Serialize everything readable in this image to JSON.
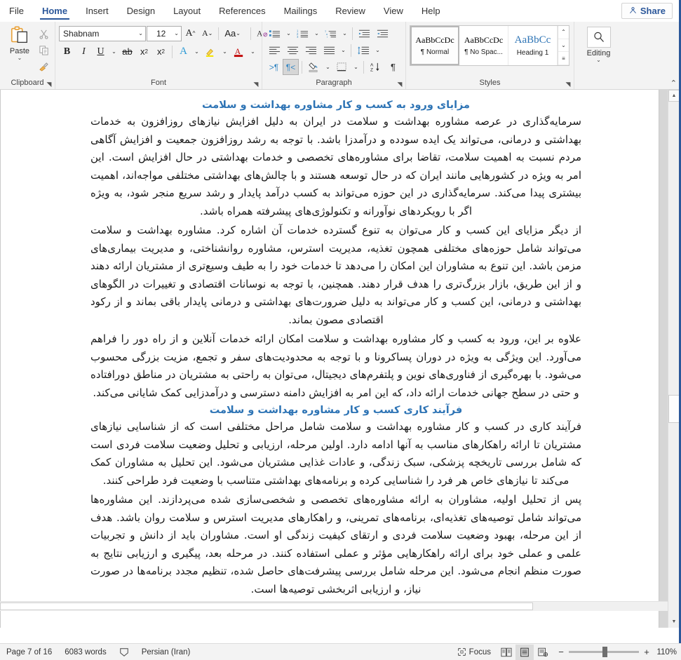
{
  "tabs": [
    {
      "label": "File",
      "active": false
    },
    {
      "label": "Home",
      "active": true
    },
    {
      "label": "Insert",
      "active": false
    },
    {
      "label": "Design",
      "active": false
    },
    {
      "label": "Layout",
      "active": false
    },
    {
      "label": "References",
      "active": false
    },
    {
      "label": "Mailings",
      "active": false
    },
    {
      "label": "Review",
      "active": false
    },
    {
      "label": "View",
      "active": false
    },
    {
      "label": "Help",
      "active": false
    }
  ],
  "share": {
    "label": "Share",
    "icon": "share-person-icon"
  },
  "ribbon": {
    "clipboard": {
      "group_label": "Clipboard",
      "paste_label": "Paste",
      "paste_caret": "⌄",
      "cut_icon": "scissors-icon",
      "copy_icon": "copy-icon",
      "format_painter_icon": "format-painter-icon",
      "launcher_icon": "dialog-launcher-icon"
    },
    "font": {
      "group_label": "Font",
      "font_name": "Shabnam",
      "font_size": "12",
      "grow_font_label": "A",
      "shrink_font_label": "A",
      "change_case_label": "Aa",
      "clear_formatting_label": "A",
      "bold_label": "B",
      "italic_label": "I",
      "underline_label": "U",
      "strikethrough_label": "ab",
      "subscript_label": "x",
      "superscript_label": "x",
      "text_effects_label": "A",
      "highlight_label": "A",
      "font_color_label": "A",
      "launcher_icon": "dialog-launcher-icon"
    },
    "paragraph": {
      "group_label": "Paragraph",
      "bullets_icon": "bullet-list-icon",
      "numbering_icon": "numbered-list-icon",
      "multilevel_icon": "multilevel-list-icon",
      "decrease_indent_icon": "decrease-indent-icon",
      "increase_indent_icon": "increase-indent-icon",
      "align_left_icon": "align-left-icon",
      "align_center_icon": "align-center-icon",
      "align_right_icon": "align-right-icon",
      "justify_icon": "justify-icon",
      "line_spacing_icon": "line-spacing-icon",
      "ltr_icon": "left-to-right-icon",
      "rtl_icon": "right-to-left-icon",
      "shading_icon": "shading-icon",
      "borders_icon": "borders-icon",
      "sort_icon": "sort-icon",
      "show_marks_label": "¶",
      "launcher_icon": "dialog-launcher-icon"
    },
    "styles": {
      "group_label": "Styles",
      "items": [
        {
          "preview": "AaBbCcDc",
          "name": "¶ Normal",
          "selected": true
        },
        {
          "preview": "AaBbCcDc",
          "name": "¶ No Spac...",
          "selected": false
        },
        {
          "preview": "AaBbCc",
          "name": "Heading 1",
          "selected": false
        }
      ],
      "scroll_up": "⌃",
      "scroll_down": "⌄",
      "more": "≡",
      "launcher_icon": "dialog-launcher-icon"
    },
    "editing": {
      "label": "Editing",
      "icon": "search-magnifier-icon",
      "caret": "⌄"
    },
    "collapse_ribbon": "⌃"
  },
  "document": {
    "blocks": [
      {
        "type": "heading",
        "text": "مزایای ورود به کسب و کار مشاوره بهداشت و سلامت"
      },
      {
        "type": "paragraph",
        "text": "سرمایه‌گذاری در عرصه مشاوره بهداشت و سلامت در ایران به دلیل افزایش نیازهای روزافزون به خدمات بهداشتی و درمانی، می‌تواند یک ایده سودده و درآمدزا باشد. با توجه به رشد روزافزون جمعیت و افزایش آگاهی مردم نسبت به اهمیت سلامت، تقاضا برای مشاوره‌های تخصصی و خدمات بهداشتی در حال افزایش است. این امر به ویژه در کشورهایی مانند ایران که در حال توسعه هستند و با چالش‌های بهداشتی مختلفی مواجه‌اند، اهمیت بیشتری پیدا می‌کند. سرمایه‌گذاری در این حوزه می‌تواند به کسب درآمد پایدار و رشد سریع منجر شود، به ویژه اگر با رویکردهای نوآورانه و تکنولوژی‌های پیشرفته همراه باشد."
      },
      {
        "type": "paragraph",
        "text": "از دیگر مزایای این کسب و کار می‌توان به تنوع گسترده خدمات آن اشاره کرد. مشاوره بهداشت و سلامت می‌تواند شامل حوزه‌های مختلفی همچون تغذیه، مدیریت استرس، مشاوره روانشناختی، و مدیریت بیماری‌های مزمن باشد. این تنوع به مشاوران این امکان را می‌دهد تا خدمات خود را به طیف وسیع‌تری از مشتریان ارائه دهند و از این طریق، بازار بزرگ‌تری را هدف قرار دهند. همچنین، با توجه به نوسانات اقتصادی و تغییرات در الگوهای بهداشتی و درمانی، این کسب و کار می‌تواند به دلیل ضرورت‌های بهداشتی و درمانی پایدار باقی بماند و از رکود اقتصادی مصون بماند."
      },
      {
        "type": "paragraph",
        "text": "علاوه بر این، ورود به کسب و کار مشاوره بهداشت و سلامت امکان ارائه خدمات آنلاین و از راه دور را فراهم می‌آورد. این ویژگی به ویژه در دوران پساکرونا و با توجه به محدودیت‌های سفر و تجمع، مزیت بزرگی محسوب می‌شود. با بهره‌گیری از فناوری‌های نوین و پلتفرم‌های دیجیتال، می‌توان به راحتی به مشتریان در مناطق دورافتاده و حتی در سطح جهانی خدمات ارائه داد، که این امر به افزایش دامنه دسترسی و درآمدزایی کمک شایانی می‌کند."
      },
      {
        "type": "heading",
        "text": "فرآیند کاری کسب و کار مشاوره بهداشت و سلامت"
      },
      {
        "type": "paragraph",
        "text": "فرآیند کاری در کسب و کار مشاوره بهداشت و سلامت شامل مراحل مختلفی است که از شناسایی نیازهای مشتریان تا ارائه راهکارهای مناسب به آنها ادامه دارد. اولین مرحله، ارزیابی و تحلیل وضعیت سلامت فردی است که شامل بررسی تاریخچه پزشکی، سبک زندگی، و عادات غذایی مشتریان می‌شود. این تحلیل به مشاوران کمک می‌کند تا نیازهای خاص هر فرد را شناسایی کرده و برنامه‌های بهداشتی متناسب با وضعیت فرد طراحی کنند."
      },
      {
        "type": "paragraph",
        "text": "پس از تحلیل اولیه، مشاوران به ارائه مشاوره‌های تخصصی و شخصی‌سازی شده می‌پردازند. این مشاوره‌ها می‌تواند شامل توصیه‌های تغذیه‌ای، برنامه‌های تمرینی، و راهکارهای مدیریت استرس و سلامت روان باشد. هدف از این مرحله، بهبود وضعیت سلامت فردی و ارتقای کیفیت زندگی او است. مشاوران باید از دانش و تجربیات علمی و عملی خود برای ارائه راهکارهایی مؤثر و عملی استفاده کنند. در مرحله بعد، پیگیری و ارزیابی نتایج به صورت منظم انجام می‌شود. این مرحله شامل بررسی پیشرفت‌های حاصل شده، تنظیم مجدد برنامه‌ها در صورت نیاز، و ارزیابی اثربخشی توصیه‌ها است."
      }
    ]
  },
  "statusbar": {
    "page_info": "Page 7 of 16",
    "word_count": "6083 words",
    "proofing_icon": "proofing-errors-icon",
    "language": "Persian (Iran)",
    "focus_label": "Focus",
    "focus_icon": "focus-mode-icon",
    "view_read_icon": "read-mode-icon",
    "view_print_icon": "print-layout-icon",
    "view_web_icon": "web-layout-icon",
    "zoom_out": "−",
    "zoom_in": "+",
    "zoom_value": "110%"
  },
  "colors": {
    "accent": "#2b579a",
    "heading": "#2e74b5",
    "ribbon_bg": "#f3f3f3",
    "doc_bg": "#d6d6d6"
  }
}
